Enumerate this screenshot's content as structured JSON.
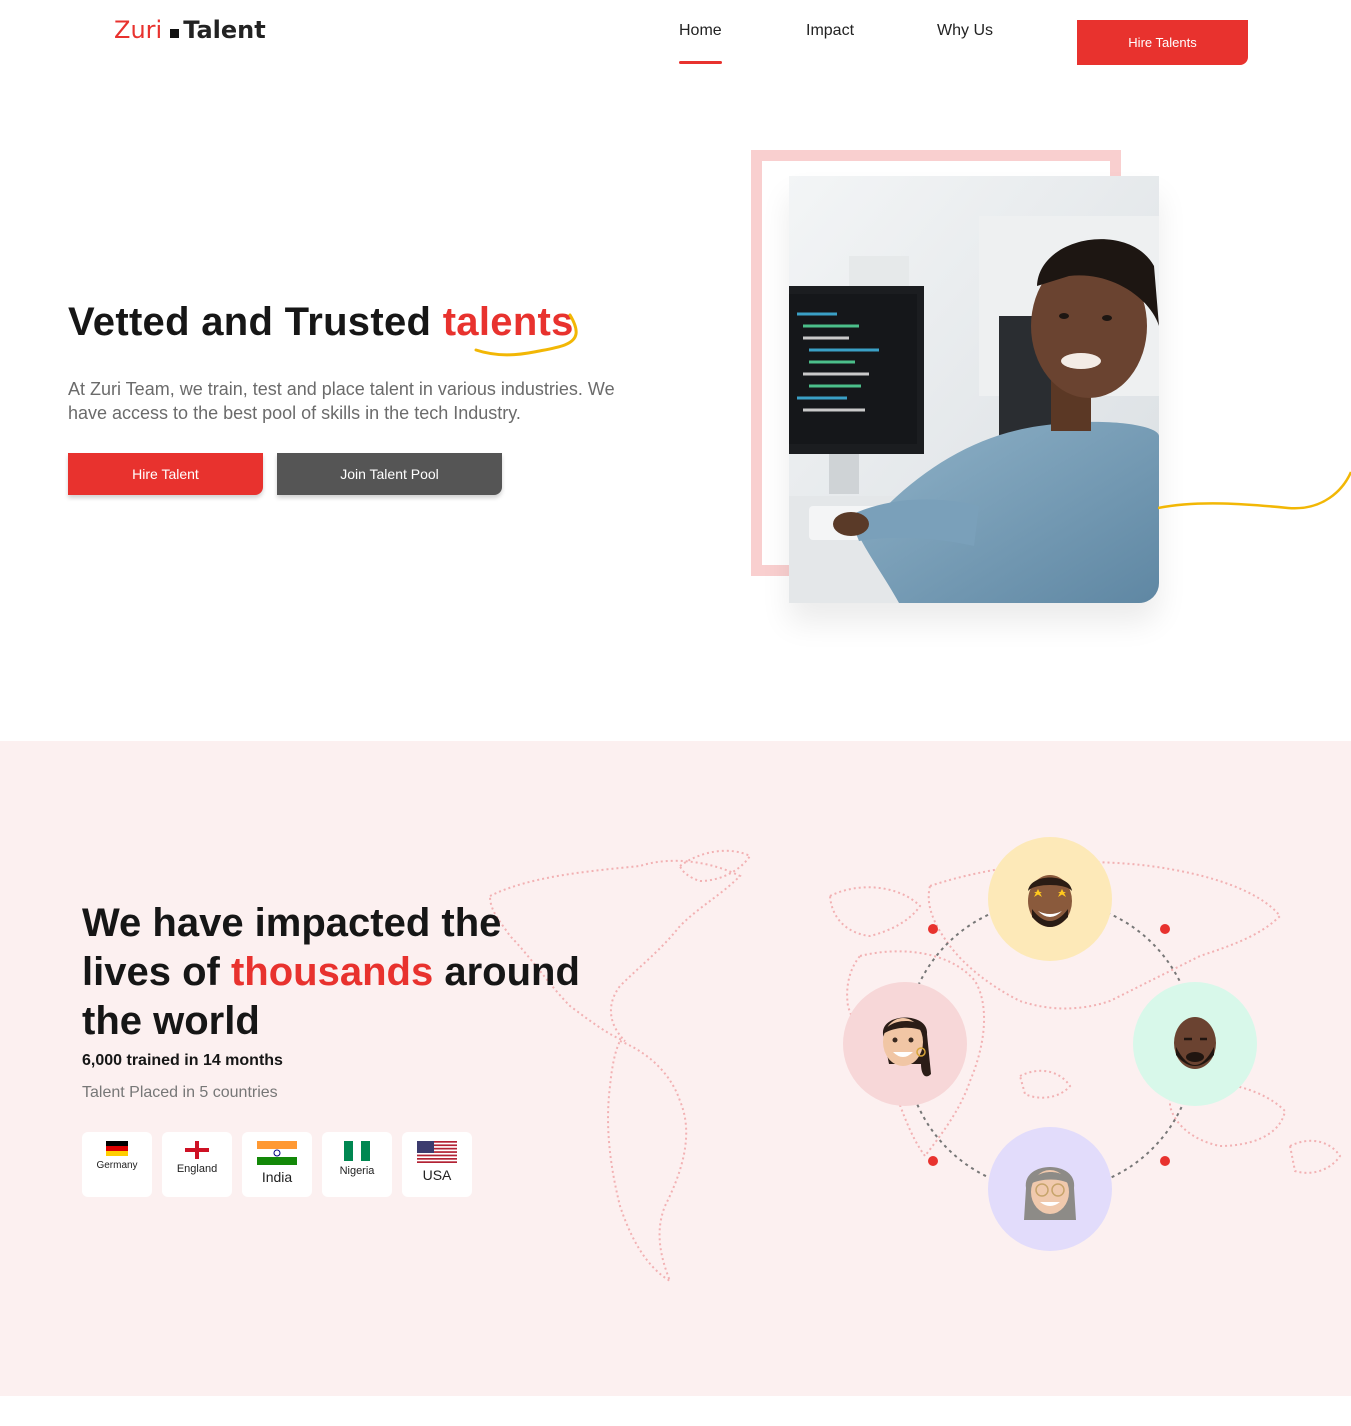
{
  "nav": {
    "logo_part1": "Zuri",
    "logo_part2": "Talent",
    "links": [
      "Home",
      "Impact",
      "Why Us"
    ],
    "active": "Home",
    "cta": "Hire Talents"
  },
  "hero": {
    "title_prefix": "Vetted and Trusted",
    "title_accent": "talents",
    "subtitle": "At Zuri Team, we train, test and place talent in various industries. We have access to the best pool of skills in the tech Industry.",
    "primary_button": "Hire Talent",
    "secondary_button": "Join Talent Pool"
  },
  "impact": {
    "title_line1": "We have impacted the",
    "title_line2_pre": "lives of",
    "title_accent": "thousands",
    "title_line2_post": "around",
    "title_line3": "the world",
    "stat": "6,000 trained in 14 months",
    "placed": "Talent Placed in 5 countries",
    "countries": [
      {
        "name": "Germany",
        "flag": "germany-flag"
      },
      {
        "name": "England",
        "flag": "england-flag"
      },
      {
        "name": "India",
        "flag": "india-flag"
      },
      {
        "name": "Nigeria",
        "flag": "nigeria-flag"
      },
      {
        "name": "USA",
        "flag": "usa-flag"
      }
    ]
  },
  "colors": {
    "accent": "#e8322e",
    "dark_button": "#555555",
    "impact_bg": "#fcf0f0",
    "frame": "#f9cfcf",
    "squiggle": "#f2b705",
    "avatar_top": "#fde9b8",
    "avatar_left": "#f7d7d8",
    "avatar_right": "#d8f8ea",
    "avatar_bottom": "#e2dcfb"
  }
}
